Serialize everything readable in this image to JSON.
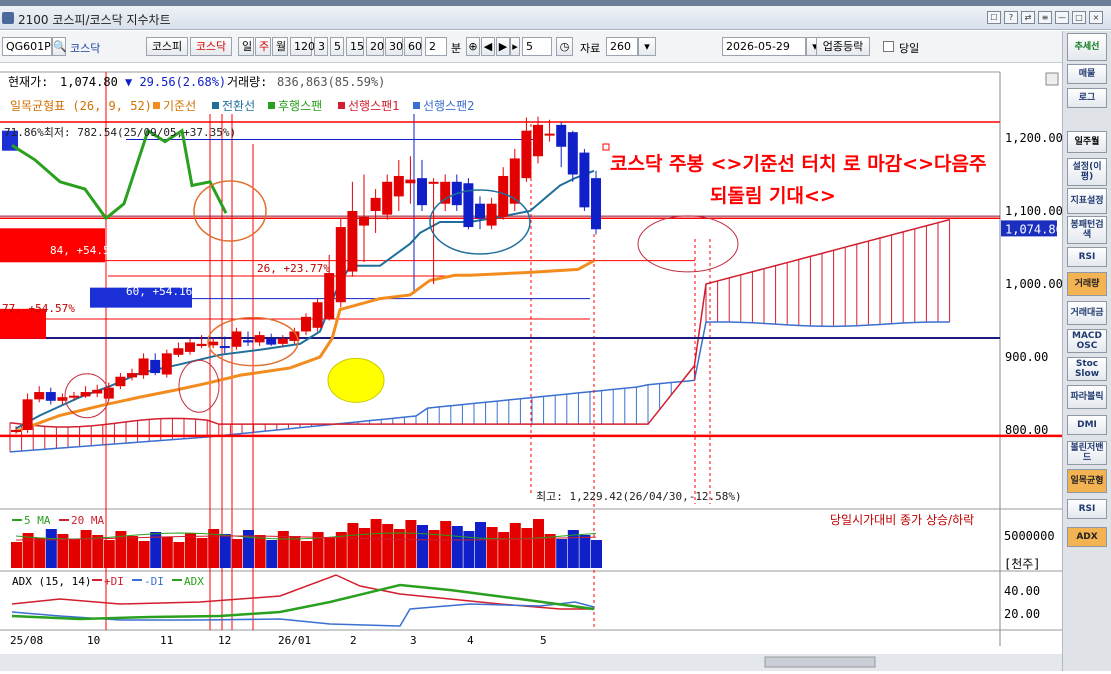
{
  "window": {
    "title": "2100 코스피/코스닥 지수차트",
    "buttons": [
      "☐",
      "?",
      "⇄",
      "≡",
      "—",
      "□",
      "×"
    ]
  },
  "toolbar": {
    "code": "QG601P",
    "name": "코스닥",
    "market_buttons": [
      "코스피",
      "코스닥"
    ],
    "periods": [
      "일",
      "주",
      "월",
      "120",
      "3",
      "5",
      "15",
      "20",
      "30",
      "60"
    ],
    "minute_value": "2",
    "minute_label": "분",
    "step_value": "5",
    "data_label": "자료",
    "data_count": "260",
    "date": "2026-05-29",
    "sector_button": "업종등락",
    "same_day_label": "당일"
  },
  "info": {
    "price_label": "현재가:",
    "price": "1,074.80",
    "change": "▼ 29.56(2.68%)",
    "volume_label": "거래량:",
    "volume": "836,863(85.59%)"
  },
  "legend": {
    "ichimoku": "일목균형표 (26, 9, 52)",
    "base": "기준선",
    "conversion": "전환선",
    "lagging": "후행스팬",
    "lead1": "선행스팬1",
    "lead2": "선행스팬2"
  },
  "annotations": {
    "comment_line1": "코스닥 주봉 <>기준선 터치 로 마감<>다음주",
    "comment_line2": "되돌림 기대<>",
    "low": "71.86%최저: 782.54(25/09/05,+37.35%)",
    "high": "최고: 1,229.42(26/04/30,-12.58%)",
    "box_84": "84, +54.57%",
    "box_60": "60, +54.16%",
    "box_77": "77, +54.57%",
    "label_26": "26, +23.77%"
  },
  "price_axis": {
    "ticks": [
      "1,200.00",
      "1,100.00",
      "1,000.00",
      "900.00",
      "800.00"
    ],
    "current": "1,074.80"
  },
  "volume_panel": {
    "legend_ma5": "5 MA",
    "legend_ma20": "20 MA",
    "title": "당일시가대비 종가 상승/하락",
    "axis_value": "5000000",
    "unit": "[천주]"
  },
  "adx_panel": {
    "legend_adx": "ADX (15, 14)",
    "legend_pdi": "+DI",
    "legend_mdi": "-DI",
    "legend_adx2": "ADX",
    "ticks": [
      "40.00",
      "20.00"
    ]
  },
  "time_axis": {
    "labels": [
      "25/08",
      "10",
      "11",
      "12",
      "26/01",
      "2",
      "3",
      "4",
      "5"
    ]
  },
  "right_panel": {
    "buttons": [
      "추세선",
      "매물",
      "로그",
      "일주월",
      "설정(이평)",
      "지표설정",
      "봉패턴검색",
      "RSI",
      "거래량",
      "거래대금",
      "MACD OSC",
      "Stoc Slow",
      "파라볼릭",
      "DMI",
      "볼린저밴드",
      "일목균형",
      "RSI",
      "ADX"
    ]
  },
  "colors": {
    "up": "#e30000",
    "down": "#1020c8",
    "base_line": "#f28c1e",
    "conversion_line": "#1f6f9a",
    "lagging_line": "#29a01e",
    "cloud_lead1": "#d21e2e",
    "cloud_lead2": "#3b6fd0",
    "annotation_red": "#ff0000"
  },
  "chart_data": [
    {
      "type": "candlestick",
      "title": "일목균형표 (26, 9, 52)",
      "categories": [
        "25/08",
        "",
        "",
        "",
        "",
        "",
        "",
        "10",
        "",
        "",
        "",
        "",
        "",
        "",
        "11",
        "",
        "",
        "",
        "",
        "",
        "12",
        "",
        "",
        "",
        "",
        "",
        "",
        "26/01",
        "",
        "",
        "",
        "",
        "2",
        "",
        "",
        "",
        "",
        "3",
        "",
        "",
        "",
        "",
        "4",
        "",
        "",
        "",
        "",
        "5",
        "",
        "",
        ""
      ],
      "open": [
        798,
        800,
        842,
        852,
        840,
        845,
        846,
        850,
        843,
        860,
        872,
        875,
        896,
        876,
        903,
        907,
        915,
        916,
        915,
        914,
        923,
        920,
        925,
        918,
        922,
        935,
        940,
        952,
        975,
        1017,
        1080,
        1100,
        1095,
        1120,
        1138,
        1145,
        1140,
        1110,
        1140,
        1138,
        1110,
        1080,
        1092,
        1110,
        1145,
        1175,
        1205,
        1218,
        1208,
        1180,
        1145
      ],
      "close": [
        800,
        842,
        852,
        840,
        845,
        847,
        852,
        855,
        858,
        873,
        878,
        898,
        878,
        905,
        912,
        920,
        918,
        921,
        914,
        935,
        920,
        930,
        917,
        925,
        935,
        955,
        975,
        1015,
        1078,
        1100,
        1092,
        1118,
        1140,
        1148,
        1143,
        1108,
        1140,
        1140,
        1108,
        1078,
        1090,
        1110,
        1148,
        1172,
        1210,
        1218,
        1206,
        1188,
        1150,
        1105,
        1075
      ],
      "high": [
        805,
        850,
        860,
        858,
        850,
        852,
        860,
        862,
        865,
        878,
        884,
        905,
        905,
        910,
        920,
        925,
        930,
        925,
        928,
        940,
        935,
        935,
        932,
        930,
        940,
        960,
        980,
        1040,
        1090,
        1140,
        1150,
        1130,
        1150,
        1170,
        1175,
        1170,
        1145,
        1150,
        1150,
        1145,
        1120,
        1118,
        1160,
        1185,
        1228,
        1229.42,
        1225,
        1222,
        1210,
        1185,
        1155
      ],
      "low": [
        795,
        796,
        838,
        835,
        835,
        840,
        844,
        845,
        840,
        856,
        868,
        870,
        875,
        872,
        900,
        903,
        912,
        912,
        905,
        910,
        915,
        915,
        915,
        915,
        918,
        930,
        935,
        950,
        968,
        1010,
        1030,
        1070,
        1088,
        1100,
        1110,
        1100,
        1000,
        1100,
        1100,
        1075,
        1075,
        1075,
        1088,
        1100,
        1140,
        1165,
        1195,
        1160,
        1140,
        1100,
        1068
      ],
      "series": [
        {
          "name": "기준선",
          "values": [
            null,
            null,
            null,
            null,
            null,
            null,
            null,
            null,
            null,
            null,
            null,
            null,
            null,
            null,
            null,
            null,
            null,
            null,
            null,
            null,
            null,
            null,
            null,
            null,
            null,
            null,
            null,
            null,
            null,
            null,
            null,
            null,
            null,
            null,
            null,
            null,
            null,
            null,
            null,
            null,
            null,
            null,
            null,
            null,
            null,
            null,
            null,
            null,
            null,
            null,
            1070
          ]
        },
        {
          "name": "전환선",
          "values": []
        },
        {
          "name": "후행스팬",
          "values": []
        },
        {
          "name": "선행스팬1",
          "values": []
        },
        {
          "name": "선행스팬2",
          "values": []
        }
      ],
      "ylim": [
        770,
        1250
      ],
      "yticks": [
        800,
        900,
        1000,
        1100,
        1200
      ]
    },
    {
      "type": "bar",
      "title": "당일시가대비 종가 상승/하락",
      "series": [
        {
          "name": "5 MA",
          "values": []
        },
        {
          "name": "20 MA",
          "values": []
        }
      ],
      "yticks": [
        5000000
      ]
    },
    {
      "type": "line",
      "title": "ADX (15, 14)",
      "series": [
        {
          "name": "+DI",
          "values": []
        },
        {
          "name": "-DI",
          "values": []
        },
        {
          "name": "ADX",
          "values": []
        }
      ],
      "yticks": [
        20,
        40
      ]
    }
  ]
}
